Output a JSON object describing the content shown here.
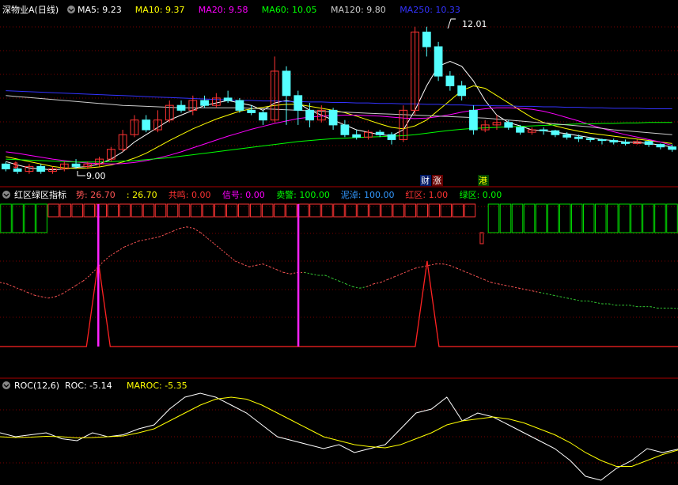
{
  "panels": {
    "main": {
      "title": "深物业A(日线)",
      "ma_labels": [
        {
          "name": "MA5",
          "value": "9.23",
          "color": "#ffffff"
        },
        {
          "name": "MA10",
          "value": "9.37",
          "color": "#ffff00"
        },
        {
          "name": "MA20",
          "value": "9.58",
          "color": "#ff00ff"
        },
        {
          "name": "MA60",
          "value": "10.05",
          "color": "#00ff00"
        },
        {
          "name": "MA120",
          "value": "9.80",
          "color": "#cccccc"
        },
        {
          "name": "MA250",
          "value": "10.33",
          "color": "#3333ff"
        }
      ],
      "high_label": "12.01",
      "low_label": "9.00",
      "markers": {
        "left": "$",
        "cai": "财",
        "zhang": "涨",
        "gang": "港"
      }
    },
    "indicator": {
      "title": "红区绿区指标",
      "labels": [
        {
          "name": "势",
          "value": "26.70",
          "color": "#ff5555"
        },
        {
          "name": "",
          "value": "26.70",
          "color": "#ffff00"
        },
        {
          "name": "共鸣",
          "value": "0.00",
          "color": "#ff3333"
        },
        {
          "name": "信号",
          "value": "0.00",
          "color": "#ff00ff"
        },
        {
          "name": "卖警",
          "value": "100.00",
          "color": "#00ff00"
        },
        {
          "name": "泥淖",
          "value": "100.00",
          "color": "#3399ff"
        },
        {
          "name": "红区",
          "value": "1.00",
          "color": "#ff3333"
        },
        {
          "name": "绿区",
          "value": "0.00",
          "color": "#00ff00"
        }
      ]
    },
    "roc": {
      "title": "ROC(12,6)",
      "labels": [
        {
          "name": "ROC",
          "value": "-5.14",
          "color": "#ffffff"
        },
        {
          "name": "MAROC",
          "value": "-5.35",
          "color": "#ffff00"
        }
      ]
    }
  },
  "chart_data": {
    "type": "candlestick",
    "price_ylim": [
      8.8,
      12.2
    ],
    "candles": [
      [
        9.2,
        9.1,
        9.25,
        9.05
      ],
      [
        9.1,
        9.05,
        9.15,
        9.0
      ],
      [
        9.05,
        9.15,
        9.2,
        9.0
      ],
      [
        9.15,
        9.05,
        9.2,
        9.0
      ],
      [
        9.05,
        9.1,
        9.15,
        9.0
      ],
      [
        9.1,
        9.2,
        9.25,
        9.05
      ],
      [
        9.2,
        9.15,
        9.3,
        9.1
      ],
      [
        9.15,
        9.2,
        9.25,
        9.1
      ],
      [
        9.2,
        9.3,
        9.35,
        9.15
      ],
      [
        9.3,
        9.5,
        9.55,
        9.25
      ],
      [
        9.5,
        9.8,
        9.9,
        9.45
      ],
      [
        9.8,
        10.1,
        10.2,
        9.75
      ],
      [
        10.1,
        9.9,
        10.2,
        9.85
      ],
      [
        9.9,
        10.1,
        10.3,
        9.85
      ],
      [
        10.1,
        10.4,
        10.5,
        10.05
      ],
      [
        10.4,
        10.3,
        10.5,
        10.25
      ],
      [
        10.3,
        10.5,
        10.6,
        10.2
      ],
      [
        10.5,
        10.4,
        10.6,
        10.35
      ],
      [
        10.4,
        10.55,
        10.65,
        10.35
      ],
      [
        10.55,
        10.5,
        10.7,
        10.45
      ],
      [
        10.5,
        10.3,
        10.55,
        10.25
      ],
      [
        10.3,
        10.25,
        10.4,
        10.2
      ],
      [
        10.25,
        10.1,
        10.3,
        10.0
      ],
      [
        10.1,
        11.1,
        11.4,
        10.05
      ],
      [
        11.1,
        10.6,
        11.2,
        10.0
      ],
      [
        10.6,
        10.3,
        10.7,
        10.0
      ],
      [
        10.3,
        10.1,
        10.45,
        9.95
      ],
      [
        10.1,
        10.3,
        10.4,
        10.05
      ],
      [
        10.3,
        10.0,
        10.35,
        9.9
      ],
      [
        10.0,
        9.8,
        10.1,
        9.75
      ],
      [
        9.8,
        9.75,
        9.9,
        9.7
      ],
      [
        9.75,
        9.85,
        9.9,
        9.7
      ],
      [
        9.85,
        9.8,
        9.9,
        9.75
      ],
      [
        9.8,
        9.7,
        9.85,
        9.6
      ],
      [
        9.7,
        10.3,
        10.4,
        9.65
      ],
      [
        10.3,
        11.9,
        12.01,
        10.2
      ],
      [
        11.9,
        11.6,
        12.01,
        11.4
      ],
      [
        11.6,
        11.0,
        11.7,
        10.9
      ],
      [
        11.0,
        10.8,
        11.1,
        10.7
      ],
      [
        10.8,
        10.6,
        10.9,
        10.5
      ],
      [
        10.3,
        9.9,
        10.4,
        9.8
      ],
      [
        9.9,
        10.0,
        10.1,
        9.85
      ],
      [
        10.0,
        10.05,
        10.2,
        9.9
      ],
      [
        10.05,
        9.95,
        10.1,
        9.9
      ],
      [
        9.95,
        9.85,
        10.0,
        9.8
      ],
      [
        9.85,
        9.9,
        9.95,
        9.8
      ],
      [
        9.9,
        9.88,
        9.95,
        9.8
      ],
      [
        9.88,
        9.8,
        9.9,
        9.75
      ],
      [
        9.8,
        9.75,
        9.85,
        9.7
      ],
      [
        9.75,
        9.72,
        9.8,
        9.65
      ],
      [
        9.72,
        9.7,
        9.75,
        9.65
      ],
      [
        9.7,
        9.68,
        9.72,
        9.6
      ],
      [
        9.68,
        9.65,
        9.72,
        9.6
      ],
      [
        9.65,
        9.62,
        9.7,
        9.58
      ],
      [
        9.62,
        9.66,
        9.7,
        9.6
      ],
      [
        9.66,
        9.6,
        9.68,
        9.55
      ],
      [
        9.6,
        9.55,
        9.62,
        9.5
      ],
      [
        9.55,
        9.5,
        9.6,
        9.45
      ]
    ],
    "ma": {
      "MA5": [
        9.25,
        9.18,
        9.12,
        9.1,
        9.08,
        9.1,
        9.13,
        9.15,
        9.2,
        9.3,
        9.45,
        9.65,
        9.8,
        9.95,
        10.1,
        10.2,
        10.3,
        10.4,
        10.45,
        10.5,
        10.45,
        10.4,
        10.3,
        10.45,
        10.5,
        10.45,
        10.3,
        10.2,
        10.1,
        10.0,
        9.9,
        9.85,
        9.8,
        9.78,
        9.9,
        10.3,
        10.8,
        11.2,
        11.3,
        11.2,
        10.9,
        10.5,
        10.2,
        10.05,
        9.98,
        9.9,
        9.88,
        9.85,
        9.82,
        9.78,
        9.74,
        9.7,
        9.68,
        9.65,
        9.64,
        9.62,
        9.59,
        9.55
      ],
      "MA10": [
        9.35,
        9.3,
        9.25,
        9.2,
        9.15,
        9.12,
        9.11,
        9.12,
        9.14,
        9.18,
        9.24,
        9.32,
        9.42,
        9.55,
        9.68,
        9.8,
        9.92,
        10.02,
        10.12,
        10.2,
        10.28,
        10.33,
        10.36,
        10.4,
        10.42,
        10.42,
        10.38,
        10.34,
        10.3,
        10.25,
        10.18,
        10.1,
        10.02,
        9.95,
        9.92,
        9.98,
        10.1,
        10.3,
        10.5,
        10.7,
        10.8,
        10.75,
        10.6,
        10.45,
        10.3,
        10.15,
        10.05,
        9.98,
        9.92,
        9.87,
        9.83,
        9.8,
        9.77,
        9.74,
        9.71,
        9.68,
        9.65,
        9.62
      ],
      "MA20": [
        9.45,
        9.42,
        9.38,
        9.34,
        9.3,
        9.27,
        9.24,
        9.22,
        9.21,
        9.2,
        9.21,
        9.23,
        9.27,
        9.32,
        9.38,
        9.45,
        9.53,
        9.61,
        9.69,
        9.77,
        9.84,
        9.91,
        9.97,
        10.03,
        10.08,
        10.13,
        10.16,
        10.18,
        10.19,
        10.2,
        10.2,
        10.19,
        10.18,
        10.16,
        10.14,
        10.13,
        10.14,
        10.17,
        10.21,
        10.26,
        10.3,
        10.33,
        10.35,
        10.35,
        10.34,
        10.32,
        10.28,
        10.22,
        10.15,
        10.08,
        10.0,
        9.93,
        9.86,
        9.8,
        9.75,
        9.7,
        9.65,
        9.58
      ],
      "MA60": [
        9.3,
        9.29,
        9.28,
        9.27,
        9.26,
        9.25,
        9.24,
        9.24,
        9.24,
        9.25,
        9.26,
        9.27,
        9.29,
        9.31,
        9.33,
        9.36,
        9.39,
        9.42,
        9.45,
        9.48,
        9.51,
        9.54,
        9.57,
        9.6,
        9.63,
        9.66,
        9.68,
        9.7,
        9.72,
        9.73,
        9.74,
        9.75,
        9.76,
        9.77,
        9.78,
        9.8,
        9.83,
        9.86,
        9.89,
        9.91,
        9.93,
        9.94,
        9.95,
        9.96,
        9.97,
        9.98,
        9.99,
        10.0,
        10.01,
        10.02,
        10.02,
        10.03,
        10.03,
        10.04,
        10.04,
        10.05,
        10.05,
        10.05
      ],
      "MA120": [
        10.6,
        10.58,
        10.56,
        10.54,
        10.52,
        10.5,
        10.48,
        10.46,
        10.44,
        10.42,
        10.4,
        10.39,
        10.38,
        10.37,
        10.36,
        10.35,
        10.35,
        10.35,
        10.35,
        10.35,
        10.35,
        10.34,
        10.33,
        10.32,
        10.31,
        10.3,
        10.29,
        10.28,
        10.27,
        10.26,
        10.25,
        10.24,
        10.23,
        10.22,
        10.21,
        10.2,
        10.19,
        10.18,
        10.17,
        10.16,
        10.15,
        10.14,
        10.12,
        10.1,
        10.08,
        10.06,
        10.04,
        10.02,
        10.0,
        9.98,
        9.96,
        9.93,
        9.9,
        9.88,
        9.86,
        9.84,
        9.82,
        9.8
      ],
      "MA250": [
        10.7,
        10.69,
        10.68,
        10.67,
        10.66,
        10.65,
        10.64,
        10.63,
        10.62,
        10.61,
        10.6,
        10.59,
        10.58,
        10.57,
        10.56,
        10.55,
        10.54,
        10.53,
        10.52,
        10.51,
        10.5,
        10.5,
        10.49,
        10.49,
        10.48,
        10.48,
        10.47,
        10.47,
        10.46,
        10.46,
        10.45,
        10.45,
        10.44,
        10.44,
        10.43,
        10.43,
        10.42,
        10.42,
        10.41,
        10.41,
        10.4,
        10.4,
        10.39,
        10.39,
        10.38,
        10.38,
        10.37,
        10.37,
        10.36,
        10.36,
        10.35,
        10.35,
        10.34,
        10.34,
        10.34,
        10.33,
        10.33,
        10.33
      ]
    },
    "indicator_ylim": [
      0,
      100
    ],
    "zone_bars": {
      "green_ranges": [
        [
          0,
          3
        ],
        [
          41,
          57
        ]
      ],
      "red_ranges": [
        [
          4,
          39
        ]
      ],
      "red_gap_index": 40
    },
    "trend_line": [
      45,
      44,
      42,
      40,
      38,
      36,
      35,
      34,
      35,
      37,
      40,
      43,
      46,
      50,
      55,
      60,
      64,
      67,
      70,
      72,
      74,
      75,
      76,
      77,
      79,
      81,
      83,
      84,
      83,
      80,
      76,
      72,
      68,
      64,
      60,
      58,
      56,
      57,
      58,
      56,
      54,
      52,
      51,
      52,
      52,
      51,
      50,
      50,
      48,
      46,
      44,
      42,
      41,
      42,
      44,
      45,
      47,
      49,
      51,
      53,
      55,
      56,
      57,
      58,
      58,
      57,
      55,
      53,
      51,
      49,
      47,
      45,
      44,
      43,
      42,
      41,
      40,
      39,
      38,
      37,
      36,
      35,
      34,
      33,
      32,
      32,
      31,
      30,
      30,
      29,
      29,
      29,
      28,
      28,
      28,
      27,
      27,
      27,
      26.7
    ],
    "signals": {
      "spike_centers": [
        0.145,
        0.63
      ],
      "magenta_x": [
        0.145,
        0.44
      ]
    },
    "roc_ylim": [
      -14,
      10
    ],
    "roc": [
      -1,
      -2,
      -1.5,
      -1,
      -2.5,
      -3,
      -1,
      -2,
      -1.5,
      0,
      1,
      5,
      8,
      9,
      8,
      6,
      4,
      1,
      -2,
      -3,
      -4,
      -5,
      -4,
      -6,
      -5,
      -4,
      0,
      4,
      5,
      8,
      2,
      4,
      3,
      1,
      -1,
      -3,
      -5,
      -8,
      -12,
      -13,
      -10,
      -8,
      -5,
      -6,
      -5.14
    ],
    "maroc": [
      -2,
      -2.2,
      -2.1,
      -1.9,
      -2,
      -2.3,
      -2.2,
      -2,
      -1.8,
      -1,
      0,
      2,
      4,
      6,
      7.5,
      8,
      7.5,
      6,
      4,
      2,
      0,
      -2,
      -3,
      -4,
      -4.5,
      -4.8,
      -4,
      -2.5,
      -1,
      1,
      2,
      2.5,
      3,
      2.5,
      1.5,
      0,
      -1.5,
      -3.5,
      -6,
      -8,
      -9.5,
      -9.5,
      -8,
      -6.5,
      -5.35
    ]
  }
}
